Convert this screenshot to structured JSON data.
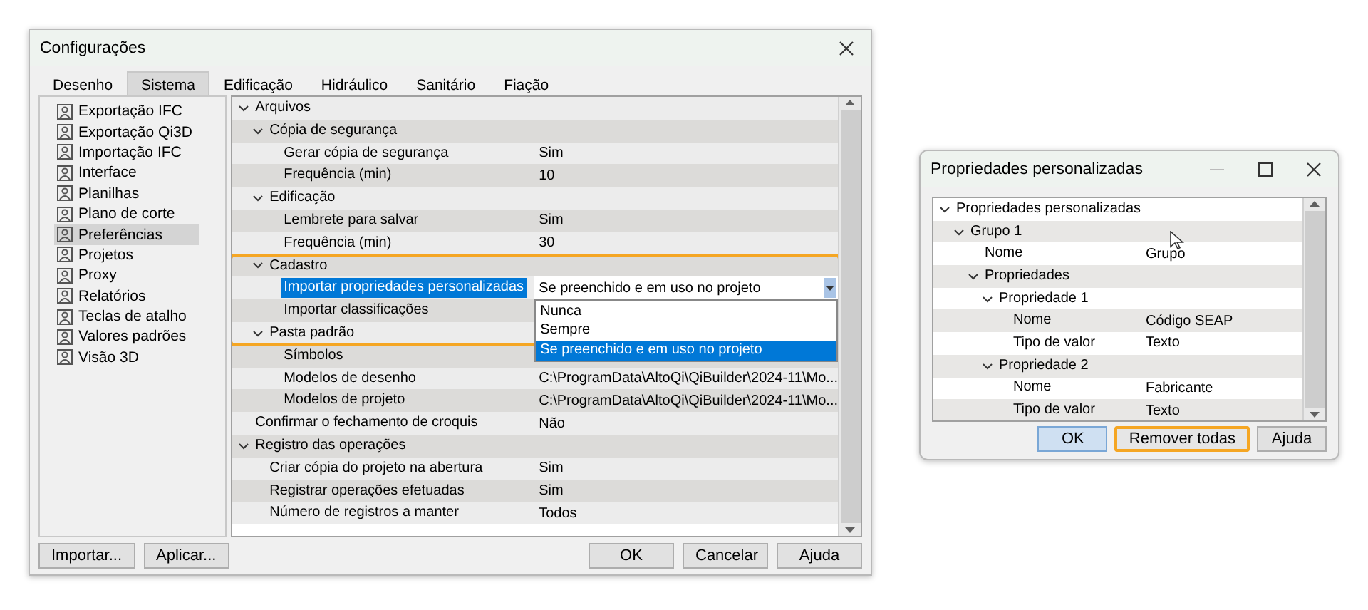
{
  "settings_window": {
    "title": "Configurações",
    "tabs": [
      {
        "label": "Desenho",
        "selected": false
      },
      {
        "label": "Sistema",
        "selected": true
      },
      {
        "label": "Edificação",
        "selected": false
      },
      {
        "label": "Hidráulico",
        "selected": false
      },
      {
        "label": "Sanitário",
        "selected": false
      },
      {
        "label": "Fiação",
        "selected": false
      }
    ],
    "sidebar": {
      "items": [
        {
          "label": "Exportação IFC",
          "selected": false
        },
        {
          "label": "Exportação Qi3D",
          "selected": false
        },
        {
          "label": "Importação IFC",
          "selected": false
        },
        {
          "label": "Interface",
          "selected": false
        },
        {
          "label": "Planilhas",
          "selected": false
        },
        {
          "label": "Plano de corte",
          "selected": false
        },
        {
          "label": "Preferências",
          "selected": true
        },
        {
          "label": "Projetos",
          "selected": false
        },
        {
          "label": "Proxy",
          "selected": false
        },
        {
          "label": "Relatórios",
          "selected": false
        },
        {
          "label": "Teclas de atalho",
          "selected": false
        },
        {
          "label": "Valores padrões",
          "selected": false
        },
        {
          "label": "Visão 3D",
          "selected": false
        }
      ]
    },
    "grid": {
      "rows": [
        {
          "label": "Arquivos",
          "expanded": true,
          "selected": false,
          "children": [
            {
              "label": "Cópia de segurança",
              "expanded": true,
              "selected": false,
              "children": [
                {
                  "label": "Gerar cópia de segurança",
                  "value": "Sim",
                  "selected": false
                },
                {
                  "label": "Frequência (min)",
                  "value": "10",
                  "selected": false
                }
              ]
            },
            {
              "label": "Edificação",
              "expanded": true,
              "selected": false,
              "children": [
                {
                  "label": "Lembrete para salvar",
                  "value": "Sim",
                  "selected": false
                },
                {
                  "label": "Frequência (min)",
                  "value": "30",
                  "selected": false
                }
              ]
            },
            {
              "label": "Cadastro",
              "expanded": true,
              "selected": false,
              "highlighted": true,
              "children": [
                {
                  "label": "Importar propriedades personalizadas",
                  "value": "Se preenchido e em uso no projeto",
                  "selected": true,
                  "dropdown": {
                    "options": [
                      {
                        "label": "Nunca",
                        "selected": false
                      },
                      {
                        "label": "Sempre",
                        "selected": false
                      },
                      {
                        "label": "Se preenchido e em uso no projeto",
                        "selected": true
                      }
                    ]
                  }
                },
                {
                  "label": "Importar classificações",
                  "selected": false
                }
              ]
            },
            {
              "label": "Pasta padrão",
              "expanded": true,
              "selected": false,
              "children": [
                {
                  "label": "Símbolos",
                  "selected": false
                },
                {
                  "label": "Modelos de desenho",
                  "value": "C:\\ProgramData\\AltoQi\\QiBuilder\\2024-11\\Mo...",
                  "selected": false
                },
                {
                  "label": "Modelos de projeto",
                  "value": "C:\\ProgramData\\AltoQi\\QiBuilder\\2024-11\\Mo...",
                  "selected": false
                }
              ]
            }
          ]
        },
        {
          "label": "Confirmar o fechamento de croquis",
          "value": "Não",
          "selected": false
        },
        {
          "label": "Registro das operações",
          "expanded": true,
          "selected": false,
          "children": [
            {
              "label": "Criar cópia do projeto na abertura",
              "value": "Sim",
              "selected": false
            },
            {
              "label": "Registrar operações efetuadas",
              "value": "Sim",
              "selected": false
            },
            {
              "label": "Número de registros a manter",
              "value": "Todos",
              "selected": false
            }
          ]
        }
      ]
    },
    "buttons_left": [
      "Importar...",
      "Aplicar..."
    ],
    "buttons_right": [
      "OK",
      "Cancelar",
      "Ajuda"
    ]
  },
  "properties_window": {
    "title": "Propriedades personalizadas",
    "grid": {
      "rows": [
        {
          "label": "Propriedades personalizadas",
          "expanded": true,
          "children": [
            {
              "label": "Grupo 1",
              "expanded": true,
              "children": [
                {
                  "label": "Nome",
                  "value": "Grupo"
                },
                {
                  "label": "Propriedades",
                  "expanded": true,
                  "children": [
                    {
                      "label": "Propriedade 1",
                      "expanded": true,
                      "children": [
                        {
                          "label": "Nome",
                          "value": "Código SEAP"
                        },
                        {
                          "label": "Tipo de valor",
                          "value": "Texto"
                        }
                      ]
                    },
                    {
                      "label": "Propriedade 2",
                      "expanded": true,
                      "children": [
                        {
                          "label": "Nome",
                          "value": "Fabricante"
                        },
                        {
                          "label": "Tipo de valor",
                          "value": "Texto"
                        }
                      ]
                    }
                  ]
                }
              ]
            }
          ]
        }
      ]
    },
    "buttons": [
      {
        "label": "OK",
        "default": true,
        "highlighted": false
      },
      {
        "label": "Remover todas",
        "default": false,
        "highlighted": true
      },
      {
        "label": "Ajuda",
        "default": false,
        "highlighted": false
      }
    ]
  }
}
